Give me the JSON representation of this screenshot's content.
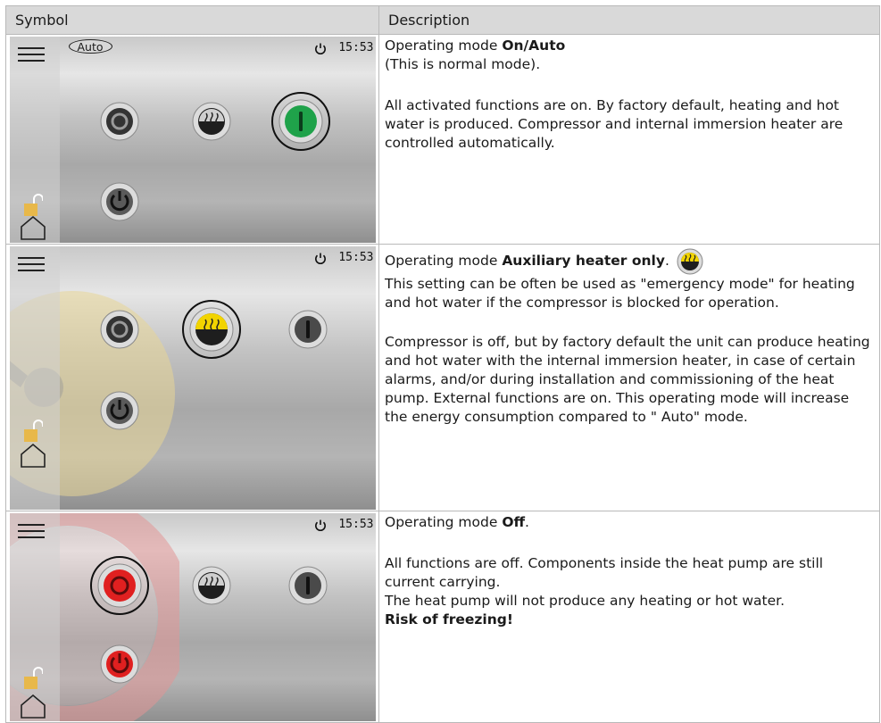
{
  "table": {
    "headers": [
      "Symbol",
      "Description"
    ]
  },
  "screens": {
    "clock": "15:53",
    "auto_badge": "Auto"
  },
  "rows": [
    {
      "prefix": "Operating mode ",
      "mode": "On/Auto",
      "line2": "(This is normal mode).",
      "para": "All activated functions are on. By factory default, heating and hot water is produced. Compressor and internal immersion heater are controlled automatically."
    },
    {
      "prefix": "Operating mode ",
      "mode": "Auxiliary heater only",
      "mode_suffix": ".",
      "para1": "This setting can be often be used as \"emergency mode\" for heating and hot water if the compressor is blocked for operation.",
      "para2": "Compressor is off, but by factory default the unit can produce heating and hot water with the internal immersion heater, in case of certain alarms, and/or during installation and commissioning of the heat pump. External functions are on. This operating mode will increase the energy consumption compared to \" Auto\" mode."
    },
    {
      "prefix": "Operating mode ",
      "mode": "Off",
      "mode_suffix": ".",
      "para1": "All functions are off. Components inside the heat pump are still current carrying.",
      "para2": "The heat pump will not produce any heating or hot water.",
      "warning": "Risk of freezing!"
    }
  ],
  "icons": {
    "menu": "hamburger-menu-icon",
    "power": "power-icon",
    "lock": "padlock-open-icon",
    "home": "home-icon",
    "off_button": "off-mode-button-icon",
    "aux_button": "auxiliary-heater-button-icon",
    "on_button": "on-mode-button-icon",
    "standby_button": "standby-power-button-icon",
    "wrench": "wrench-icon"
  },
  "colors": {
    "on_green": "#1fa24a",
    "aux_yellow": "#f2d400",
    "off_red": "#e02020",
    "lock_gold": "#e8b84a",
    "header_bg": "#d9d9d9"
  }
}
